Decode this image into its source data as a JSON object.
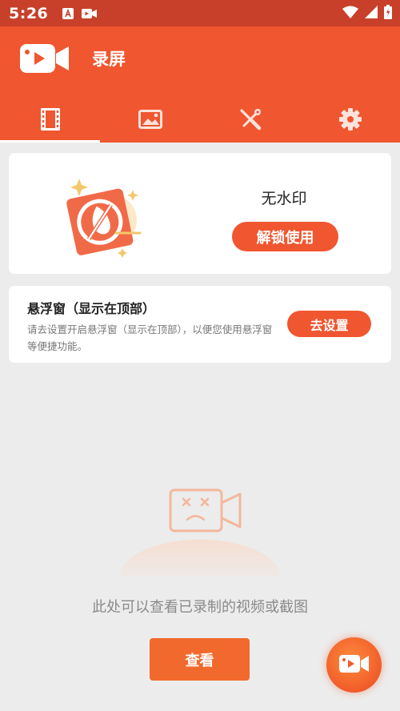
{
  "status_bar": {
    "time": "5:26",
    "icons": [
      "notification-a-icon",
      "video-record-icon",
      "wifi-icon",
      "signal-icon",
      "battery-icon"
    ]
  },
  "app_bar": {
    "title": "录屏",
    "tabs": [
      {
        "name": "videos",
        "icon": "film-icon",
        "active": true
      },
      {
        "name": "images",
        "icon": "image-icon",
        "active": false
      },
      {
        "name": "tools",
        "icon": "tools-icon",
        "active": false
      },
      {
        "name": "settings",
        "icon": "gear-icon",
        "active": false
      }
    ]
  },
  "watermark_card": {
    "title": "无水印",
    "button_label": "解锁使用"
  },
  "floating_window_card": {
    "title": "悬浮窗（显示在顶部）",
    "description": "请去设置开启悬浮窗（显示在顶部），以便您使用悬浮窗等便捷功能。",
    "button_label": "去设置"
  },
  "empty_state": {
    "message": "此处可以查看已录制的视频或截图",
    "button_label": "查看"
  },
  "colors": {
    "status_bar": "#c8402a",
    "primary": "#f0562f",
    "background": "#ececec"
  }
}
